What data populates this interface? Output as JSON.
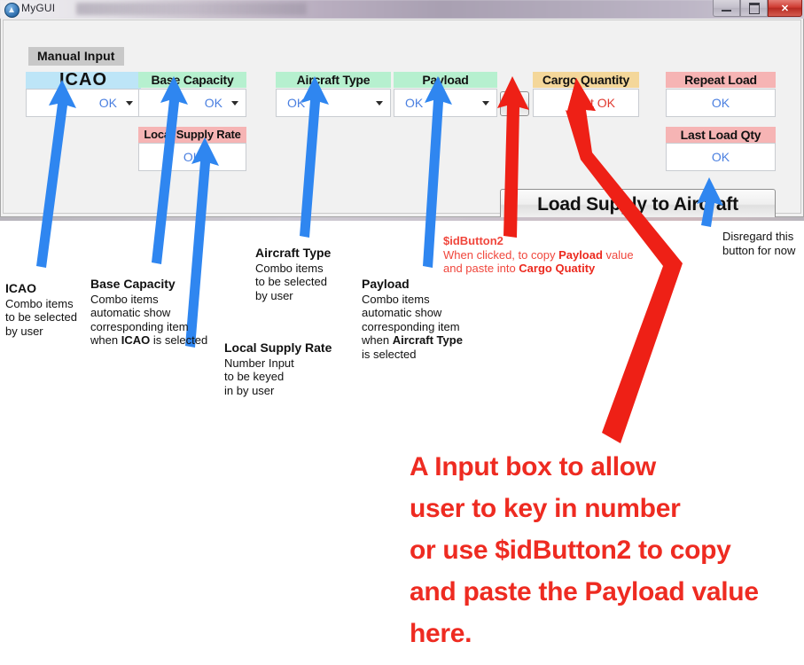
{
  "window": {
    "title": "MyGUI",
    "icon": "app-logo-icon",
    "buttons": {
      "minimize": "minimize-icon",
      "maximize": "maximize-icon",
      "close": "✕"
    }
  },
  "form": {
    "group_label": "Manual Input",
    "fields": [
      {
        "key": "icao",
        "label": "ICAO",
        "value": "OK",
        "header_color": "#bde5f7",
        "type": "combobox"
      },
      {
        "key": "basecap",
        "label": "Base Capacity",
        "value": "OK",
        "header_color": "#b6f0cf",
        "type": "combobox"
      },
      {
        "key": "lsr",
        "label": "Local Supply Rate",
        "value": "OK",
        "header_color": "#f6b4b4",
        "type": "input"
      },
      {
        "key": "acft",
        "label": "Aircraft Type",
        "value": "OK",
        "header_color": "#b6f0cf",
        "type": "combobox"
      },
      {
        "key": "payload",
        "label": "Payload",
        "value": "OK",
        "header_color": "#b6f0cf",
        "type": "combobox"
      },
      {
        "key": "cargo",
        "label": "Cargo Quantity",
        "value": "Not OK",
        "header_color": "#f4d79a",
        "type": "input"
      },
      {
        "key": "repeat",
        "label": "Repeat Load",
        "value": "OK",
        "header_color": "#f6b4b4",
        "type": "input"
      },
      {
        "key": "lastload",
        "label": "Last Load Qty",
        "value": "OK",
        "header_color": "#f6b4b4",
        "type": "input"
      }
    ],
    "copy_button": ">>",
    "load_button": "Load Supply to Aircraft"
  },
  "annotations": {
    "icao": {
      "title": "ICAO",
      "lines": [
        "Combo items",
        "to be selected",
        "by user"
      ]
    },
    "basecap": {
      "title": "Base Capacity",
      "lines": [
        "Combo items",
        "automatic show",
        "corresponding item",
        "when ICAO is selected"
      ]
    },
    "acft": {
      "title": "Aircraft Type",
      "lines": [
        "Combo items",
        "to be selected",
        "by user"
      ]
    },
    "lsr": {
      "title": "Local Supply Rate",
      "lines": [
        "Number Input",
        "to be keyed",
        "in by user"
      ]
    },
    "payload": {
      "title": "Payload",
      "lines": [
        "Combo items",
        "automatic show",
        "corresponding item",
        "when Aircraft Type",
        "is selected"
      ]
    },
    "sidbutton": {
      "title": "$idButton2",
      "lines": [
        "When clicked, to copy Payload value",
        "and paste into Cargo Quatity"
      ]
    },
    "disregard": {
      "lines": [
        "Disregard this",
        "button for now"
      ]
    },
    "big": {
      "lines": [
        "A Input box to allow",
        "user to key in number",
        "or use $idButton2 to copy",
        "and paste the Payload value",
        "here."
      ]
    }
  },
  "colors": {
    "blue_arrow": "#2f86f0",
    "red_arrow": "#ee2016",
    "value_blue": "#4a7fe0",
    "value_red": "#e03a30"
  }
}
